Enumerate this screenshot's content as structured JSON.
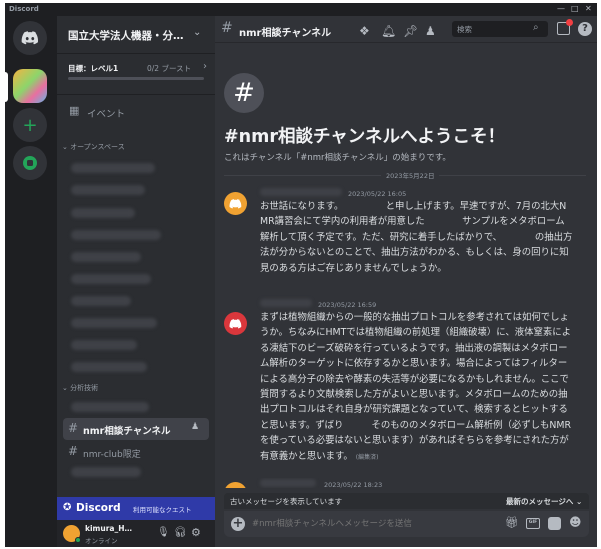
{
  "app": {
    "title": "Discord"
  },
  "window": {
    "minimize": "—",
    "maximize": "□",
    "close": "✕"
  },
  "server": {
    "name": "国立大学法人機器・分…",
    "goal_label": "目標：レベル1",
    "boost": "0/2 ブースト",
    "boost_arrow": "›"
  },
  "sidebar": {
    "events": "イベント",
    "section_open": "オープンスペース",
    "section_analysis": "分析技術",
    "channel_active": "nmr相談チャンネル",
    "channel_limited": "nmr-club限定"
  },
  "promo": {
    "brand": "Discord",
    "text": "利用可能なクエスト"
  },
  "user": {
    "name": "kimura_H…",
    "status": "オンライン"
  },
  "header": {
    "channel": "nmr相談チャンネル",
    "search_placeholder": "検索"
  },
  "welcome": {
    "title": "#nmr相談チャンネルへようこそ！",
    "subtitle": "これはチャンネル「#nmr相談チャンネル」の始まりです。",
    "date_divider": "2023年5月22日"
  },
  "messages": [
    {
      "timestamp": "2023/05/22 16:05",
      "text": "お世話になります。　　　　　と申し上げます。早速ですが、7月の北大NMR講習会にて学内の利用者が用意した　　　　サンプルをメタボローム解析して頂く予定です。ただ、研究に着手したばかりで、　　　　の抽出方法が分からないとのことで、抽出方法がわかる、もしくは、身の回りに知見のある方はご存じありませんでしょうか。",
      "avatar_color": "#f0a232"
    },
    {
      "timestamp": "2023/05/22 16:59",
      "text": "まずは植物組織からの一般的な抽出プロトコルを参考されては如何でしょうか。ちなみにHMTでは植物組織の前処理（組織破壊）に、液体窒素による凍結下のビーズ破砕を行っているようです。抽出液の調製はメタボローム解析のターゲットに依存するかと思います。場合によってはフィルターによる高分子の除去や酵素の失活等が必要になるかもしれません。ここで質問するより文献検索した方がよいと思います。メタボロームのための抽出プロトコルはそれ自身が研究課題となっていて、検索するとヒットすると思います。ずばり　　　そのもののメタボローム解析例（必ずしもNMRを使っている必要はないと思います）があればそちらを参考にされた方が有意義かと思います。",
      "edited": "(編集済)",
      "avatar_color": "#da373c"
    },
    {
      "timestamp": "2023/05/22 18:23",
      "avatar_color": "#f0a232"
    }
  ],
  "banner": {
    "left": "古いメッセージを表示しています",
    "right": "最新のメッセージへ ⌄"
  },
  "composer": {
    "placeholder": "#nmr相談チャンネルへメッセージを送信"
  }
}
